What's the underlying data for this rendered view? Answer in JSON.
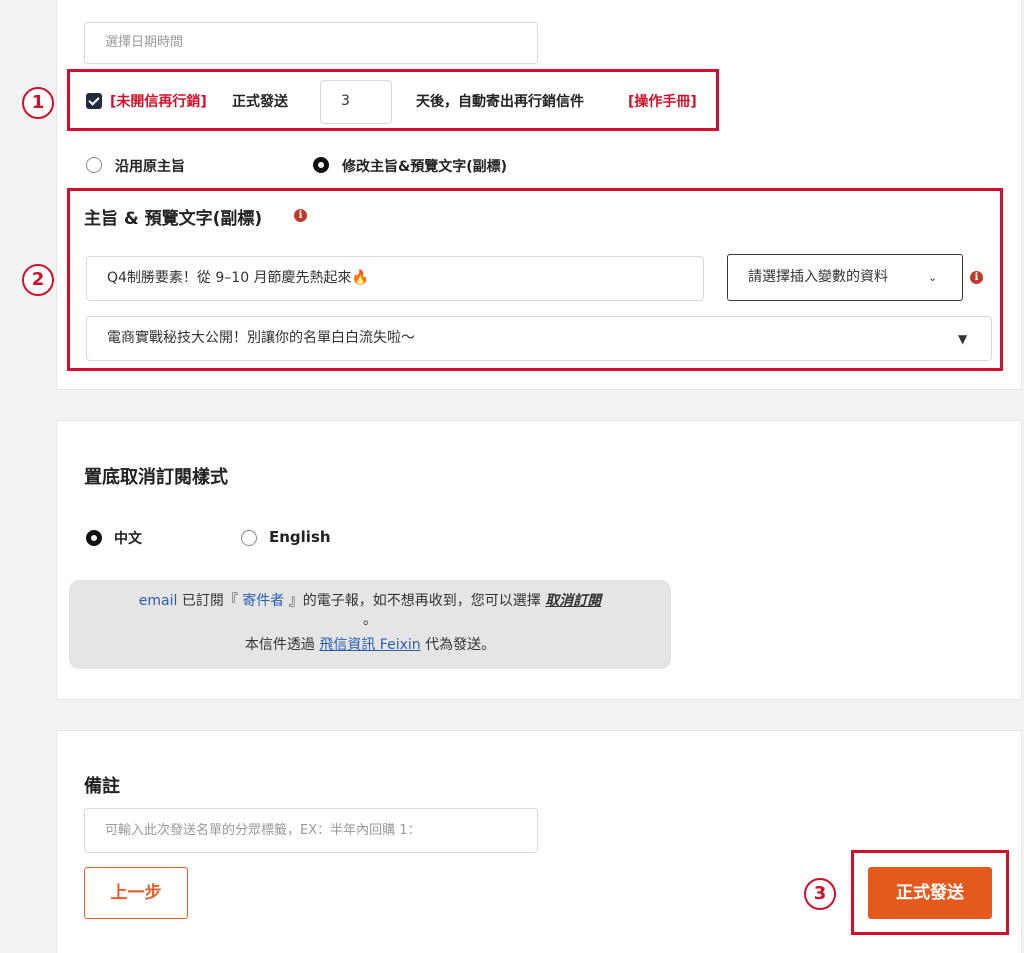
{
  "datetime": {
    "placeholder": "選擇日期時間"
  },
  "retarget": {
    "tag": "[未開信再行銷]",
    "label": "正式發送",
    "days_value": "3",
    "suffix": "天後，自動寄出再行銷信件",
    "manual_link": "[操作手冊]"
  },
  "subject_mode": {
    "options": [
      "沿用原主旨",
      "修改主旨&預覽文字(副標)"
    ],
    "selected": "修改主旨&預覽文字(副標)"
  },
  "subject": {
    "title": "主旨 & 預覽文字(副標)",
    "value": "Q4制勝要素！從 9–10 月節慶先熱起來🔥",
    "variable_select": "請選擇插入變數的資料",
    "preview_text": "電商實戰秘技大公開！別讓你的名單白白流失啦～"
  },
  "unsubscribe": {
    "title": "置底取消訂閱樣式",
    "languages": [
      "中文",
      "English"
    ],
    "selected": "中文",
    "preview": {
      "line1_a": "email",
      "line1_b": " 已訂閱『 ",
      "line1_sender": "寄件者",
      "line1_c": " 』的電子報，如不想再收到，您可以選擇 ",
      "line1_link": "取消訂閱",
      "line2": "。",
      "line3_a": "本信件透過 ",
      "line3_link": "飛信資訊 Feixin",
      "line3_b": " 代為發送。"
    }
  },
  "notes": {
    "title": "備註",
    "placeholder": "可輸入此次發送名單的分眾標籤，EX：半年內回購 1："
  },
  "buttons": {
    "back": "上一步",
    "send": "正式發送"
  },
  "markers": [
    "1",
    "2",
    "3"
  ],
  "colors": {
    "annotation_red": "#d0102a",
    "primary_orange": "#e45a1d",
    "link_blue": "#2a5db0"
  }
}
